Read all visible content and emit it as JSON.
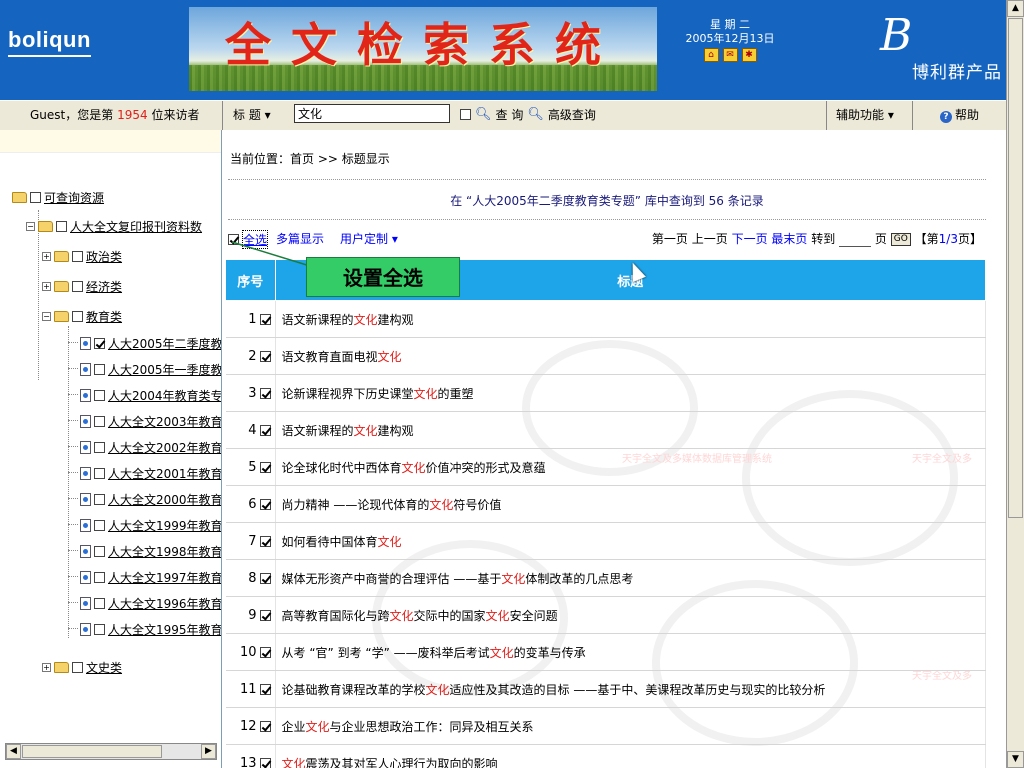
{
  "header": {
    "logo": "boliqun",
    "banner_title": "全文检索系统",
    "weekday": "星 期 二",
    "date": "2005年12月13日",
    "brand_text": "博利群产品",
    "brand_mark": "B",
    "icons": [
      "home-icon",
      "mail-icon",
      "bookmark-icon"
    ]
  },
  "toolbar": {
    "visitor_prefix": "Guest，您是第",
    "visitor_count": "1954",
    "visitor_suffix": "位来访者",
    "field_select": "标  题 ▾",
    "search_value": "文化",
    "search_label": "查 询",
    "advanced_label": "高级查询",
    "tools_menu": "辅助功能 ▾",
    "help": "帮助"
  },
  "tree": {
    "root": "可查询资源",
    "level1": "人大全文复印报刊资料数",
    "cat_politics": "政治类",
    "cat_economy": "经济类",
    "cat_education": "教育类",
    "cat_history": "文史类",
    "edu_items": [
      "人大2005年二季度教",
      "人大2005年一季度教",
      "人大2004年教育类专",
      "人大全文2003年教育",
      "人大全文2002年教育",
      "人大全文2001年教育",
      "人大全文2000年教育",
      "人大全文1999年教育",
      "人大全文1998年教育",
      "人大全文1997年教育",
      "人大全文1996年教育",
      "人大全文1995年教育"
    ]
  },
  "main": {
    "breadcrumb": "当前位置：首页 >> 标题显示",
    "result_prefix": "在 “人大2005年二季度教育类专题” 库中查询到",
    "result_count": "56",
    "result_suffix": "条记录",
    "select_all": "全选",
    "multi_view": "多篇显示",
    "custom_menu": "用户定制 ▾",
    "pager": {
      "first": "第一页",
      "prev": "上一页",
      "next": "下一页",
      "last": "最末页",
      "goto_prefix": "转到",
      "goto_suffix": "页",
      "go": "GO",
      "info_open": "【第",
      "current": "1/3",
      "info_close": "页】"
    },
    "col_no": "序号",
    "col_title": "标题",
    "callout": "设置全选",
    "watermark_text": "天宇全文及多媒体数据库管理系统",
    "watermark_text_short": "天宇全文及多"
  },
  "rows": [
    {
      "no": "1",
      "parts": [
        "语文新课程的",
        "文化",
        "建构观"
      ]
    },
    {
      "no": "2",
      "parts": [
        "语文教育直面电视",
        "文化",
        ""
      ]
    },
    {
      "no": "3",
      "parts": [
        "论新课程视界下历史课堂",
        "文化",
        "的重塑"
      ]
    },
    {
      "no": "4",
      "parts": [
        "语文新课程的",
        "文化",
        "建构观"
      ]
    },
    {
      "no": "5",
      "parts": [
        "论全球化时代中西体育",
        "文化",
        "价值冲突的形式及意蕴"
      ]
    },
    {
      "no": "6",
      "parts": [
        "尚力精神    ——论现代体育的",
        "文化",
        "符号价值"
      ]
    },
    {
      "no": "7",
      "parts": [
        "如何看待中国体育",
        "文化",
        ""
      ]
    },
    {
      "no": "8",
      "parts": [
        "媒体无形资产中商誉的合理评估    ——基于",
        "文化",
        "体制改革的几点思考"
      ]
    },
    {
      "no": "9",
      "parts": [
        "高等教育国际化与跨",
        "文化",
        "交际中的国家",
        "文化",
        "安全问题"
      ]
    },
    {
      "no": "10",
      "parts": [
        "从考 “官” 到考 “学”    ——废科举后考试",
        "文化",
        "的变革与传承"
      ]
    },
    {
      "no": "11",
      "parts": [
        "论基础教育课程改革的学校",
        "文化",
        "适应性及其改造的目标    ——基于中、美课程改革历史与现实的比较分析"
      ]
    },
    {
      "no": "12",
      "parts": [
        "企业",
        "文化",
        "与企业思想政治工作：同异及相互关系"
      ]
    },
    {
      "no": "13",
      "parts": [
        "",
        "文化",
        "震荡及其对军人心理行为取向的影响"
      ]
    }
  ]
}
